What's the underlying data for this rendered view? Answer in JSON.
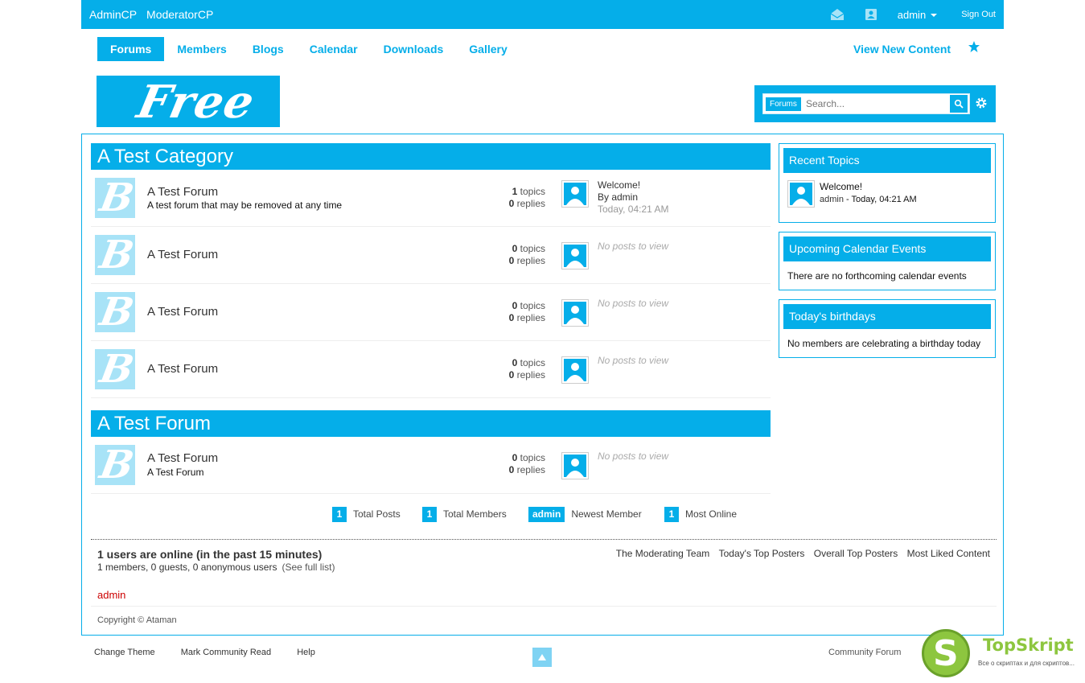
{
  "topbar": {
    "left_links": [
      "AdminCP",
      "ModeratorCP"
    ],
    "user": "admin",
    "signout": "Sign Out"
  },
  "nav": {
    "tabs": [
      "Forums",
      "Members",
      "Blogs",
      "Calendar",
      "Downloads",
      "Gallery"
    ],
    "active": "Forums",
    "view_new": "View New Content"
  },
  "logo": {
    "text": "Free"
  },
  "search": {
    "scope": "Forums",
    "placeholder": "Search..."
  },
  "categories": [
    {
      "title": "A Test Category",
      "forums": [
        {
          "name": "A Test Forum",
          "desc": "A test forum that may be removed at any time",
          "topics": "1",
          "replies": "0",
          "last_title": "Welcome!",
          "last_by": "By admin",
          "last_time": "Today, 04:21 AM"
        },
        {
          "name": "A Test Forum",
          "desc": "",
          "topics": "0",
          "replies": "0",
          "no_posts": "No posts to view"
        },
        {
          "name": "A Test Forum",
          "desc": "",
          "topics": "0",
          "replies": "0",
          "no_posts": "No posts to view"
        },
        {
          "name": "A Test Forum",
          "desc": "",
          "topics": "0",
          "replies": "0",
          "no_posts": "No posts to view"
        }
      ]
    },
    {
      "title": "A Test Forum",
      "forums": [
        {
          "name": "A Test Forum",
          "desc": "A Test Forum",
          "topics": "0",
          "replies": "0",
          "no_posts": "No posts to view"
        }
      ]
    }
  ],
  "labels": {
    "topics": "topics",
    "replies": "replies"
  },
  "stats": [
    {
      "num": "1",
      "label": "Total Posts"
    },
    {
      "num": "1",
      "label": "Total Members"
    },
    {
      "num": "admin",
      "label": "Newest Member"
    },
    {
      "num": "1",
      "label": "Most Online"
    }
  ],
  "online": {
    "heading": "1 users are online (in the past 15 minutes)",
    "sub": "1 members, 0 guests, 0 anonymous users",
    "full_list": "(See full list)",
    "user": "admin",
    "links": [
      "The Moderating Team",
      "Today's Top Posters",
      "Overall Top Posters",
      "Most Liked Content"
    ]
  },
  "copyright": "Copyright © Ataman",
  "sidebar": {
    "recent": {
      "title": "Recent Topics",
      "topic": "Welcome!",
      "by": "admin",
      "time": "- Today, 04:21 AM"
    },
    "calendar": {
      "title": "Upcoming Calendar Events",
      "body": "There are no forthcoming calendar events"
    },
    "birthdays": {
      "title": "Today's birthdays",
      "body": "No members are celebrating a birthday today"
    }
  },
  "footer": {
    "left_links": [
      "Change Theme",
      "Mark Community Read",
      "Help"
    ],
    "right": "Community Forum"
  },
  "watermark": {
    "letter": "S",
    "brand": "TopSkript",
    "tagline": "Все о скриптах и для скриптов..."
  },
  "colors": {
    "accent": "#05aee9",
    "online_user": "#cc0000"
  }
}
